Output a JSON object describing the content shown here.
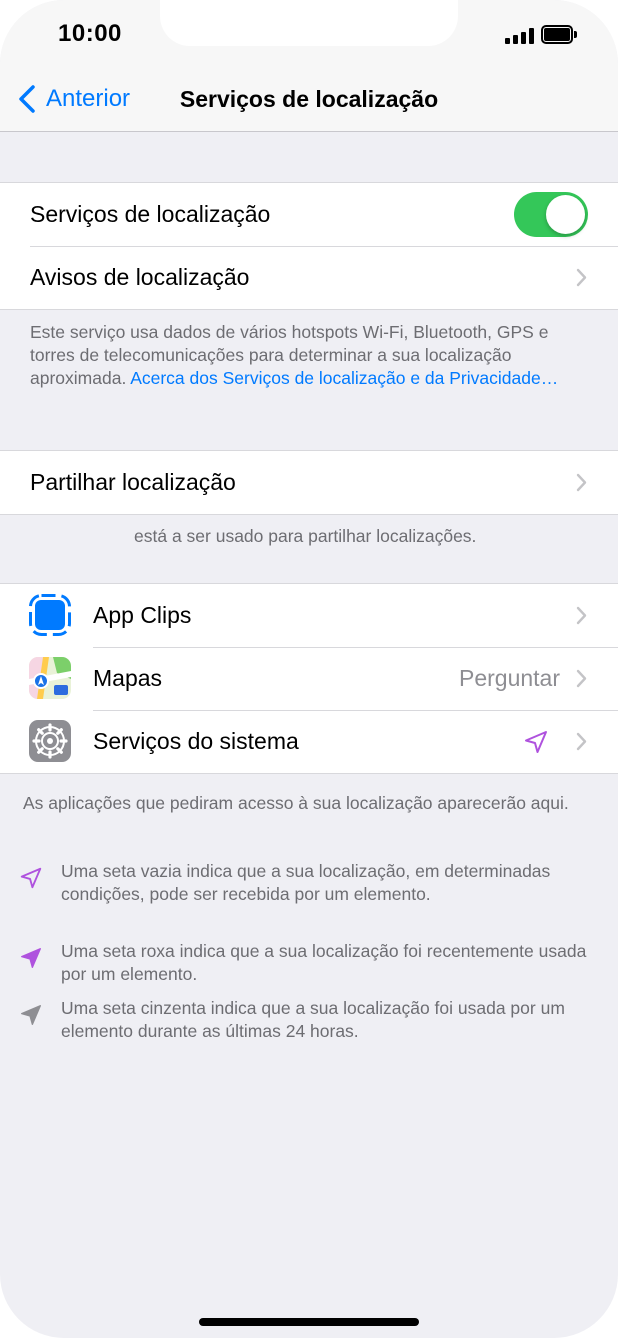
{
  "status_bar": {
    "time": "10:00"
  },
  "nav": {
    "back_label": "Anterior",
    "title": "Serviços de localização"
  },
  "group1": {
    "location_services_label": "Serviços de localização",
    "location_services_on": true,
    "location_alerts_label": "Avisos de localização"
  },
  "footnote1": {
    "text": "Este serviço usa dados de vários hotspots Wi-Fi, Bluetooth, GPS e torres de telecomunicações para determinar a sua localização aproximada. ",
    "link": "Acerca dos Serviços de localização e da Privacidade…"
  },
  "share": {
    "label": "Partilhar localização",
    "note": "está a ser usado para partilhar localizações."
  },
  "apps": [
    {
      "label": "App Clips",
      "value": "",
      "icon": "app-clips-icon"
    },
    {
      "label": "Mapas",
      "value": "Perguntar",
      "icon": "maps-icon"
    },
    {
      "label": "Serviços do sistema",
      "value": "",
      "icon": "settings-gear-icon",
      "arrow_icon": "location-arrow-outline-icon"
    }
  ],
  "apps_note": "As aplicações que pediram acesso à sua localização aparecerão aqui.",
  "legend": [
    {
      "icon": "location-arrow-outline-icon",
      "text": "Uma seta vazia indica que a sua localização, em determinadas condições, pode ser recebida por um elemento."
    },
    {
      "icon": "location-arrow-filled-purple-icon",
      "text": "Uma seta roxa indica que a sua localização foi recentemente usada por um elemento."
    },
    {
      "icon": "location-arrow-filled-gray-icon",
      "text": "Uma seta cinzenta indica que a sua localização foi usada por um elemento durante as últimas 24 horas."
    }
  ],
  "colors": {
    "accent": "#007aff",
    "toggle_on": "#34c759",
    "purple_arrow": "#af52de",
    "gray_arrow": "#8e8e93"
  }
}
